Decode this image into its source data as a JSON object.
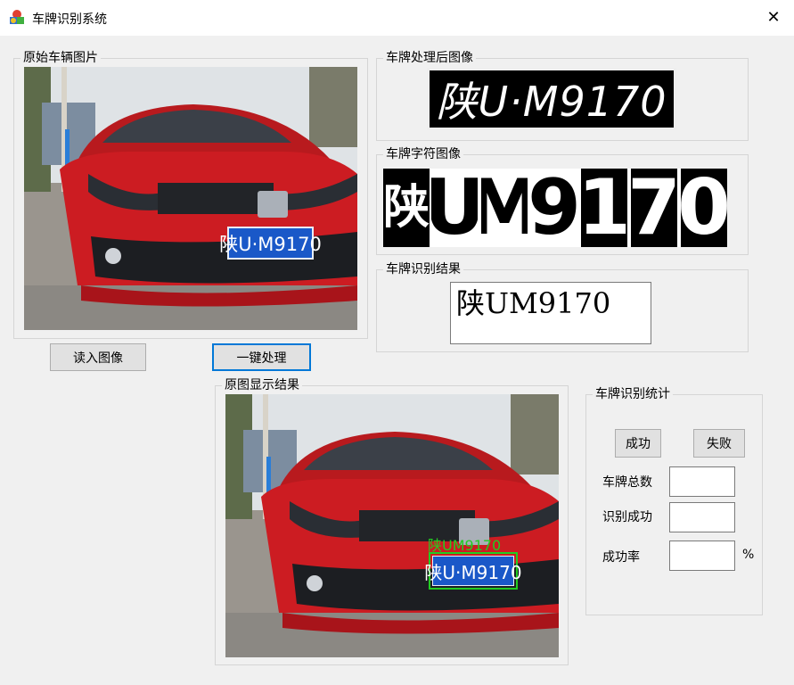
{
  "window": {
    "title": "车牌识别系统",
    "close_glyph": "✕"
  },
  "groups": {
    "original": "原始车辆图片",
    "processed": "车牌处理后图像",
    "chars": "车牌字符图像",
    "result": "车牌识别结果",
    "display": "原图显示结果",
    "stats": "车牌识别统计"
  },
  "buttons": {
    "load": "读入图像",
    "process": "一键处理",
    "success": "成功",
    "fail": "失败"
  },
  "plate": {
    "prefix": "陕",
    "blue_text": "陕U·M9170",
    "bw_text": "陕U·M9170",
    "chars": [
      "陕",
      "U",
      "M",
      "9",
      "1",
      "7",
      "0"
    ],
    "result_text": "陕UM9170",
    "overlay_text": "陕UM9170"
  },
  "stats": {
    "total_label": "车牌总数",
    "success_label": "识别成功",
    "rate_label": "成功率",
    "rate_unit": "%",
    "total_value": "",
    "success_value": "",
    "rate_value": ""
  },
  "colors": {
    "car_red": "#c8191e",
    "plate_blue": "#1a58c8",
    "detect_green": "#22cc22",
    "focus_blue": "#0078d7"
  }
}
